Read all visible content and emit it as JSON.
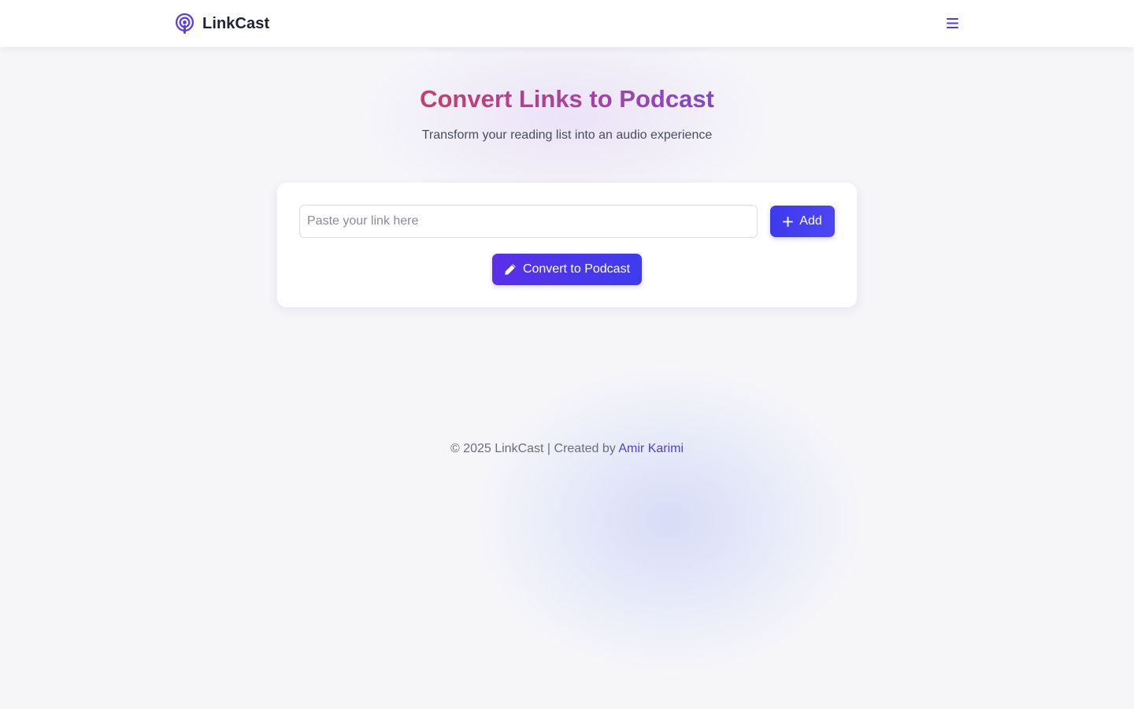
{
  "header": {
    "brand_name": "LinkCast",
    "brand_icon": "podcast-icon",
    "menu_icon": "hamburger-menu-icon"
  },
  "hero": {
    "title": "Convert Links to Podcast",
    "subtitle": "Transform your reading list into an audio experience"
  },
  "form": {
    "link_input_value": "",
    "link_input_placeholder": "Paste your link here",
    "add_label": "Add",
    "add_icon": "plus-icon",
    "convert_label": "Convert to Podcast",
    "convert_icon": "pencil-icon"
  },
  "footer": {
    "copyright": "© 2025 LinkCast | Created by",
    "author": "Amir Karimi"
  },
  "colors": {
    "accent": "#4f3ee0",
    "button_primary": "#3d39ee",
    "title_gradient_start": "#c2406e",
    "title_gradient_end": "#7e4ac6",
    "background": "#f6f6f9"
  }
}
